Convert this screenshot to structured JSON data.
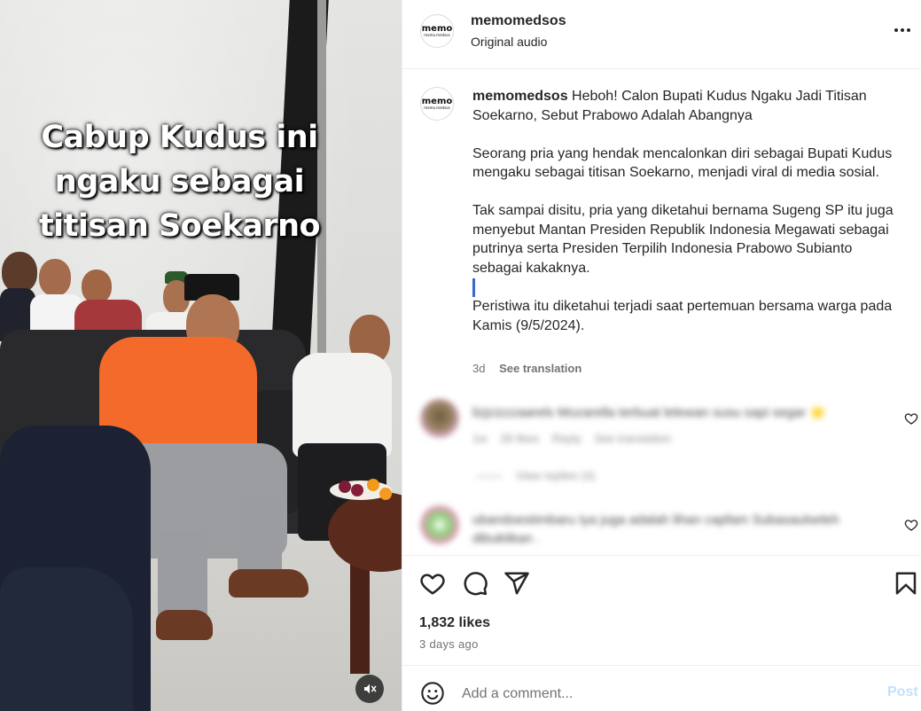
{
  "media": {
    "overlay_lines": [
      "Cabup Kudus ini",
      "ngaku sebagai",
      "titisan Soekarno"
    ],
    "mute_icon": "speaker-muted-icon"
  },
  "header": {
    "username": "memomedsos",
    "audio": "Original audio",
    "avatar_logo": "memo",
    "avatar_logo_sub": "memo.medsos"
  },
  "caption": {
    "username": "memomedsos",
    "paragraphs": [
      "Heboh! Calon Bupati Kudus Ngaku Jadi Titisan Soekarno, Sebut Prabowo Adalah Abangnya",
      "Seorang pria yang hendak mencalonkan diri sebagai Bupati Kudus mengaku sebagai titisan Soekarno, menjadi viral di media sosial.",
      "Tak sampai disitu, pria yang diketahui bernama Sugeng SP itu juga menyebut Mantan Presiden Republik Indonesia Megawati sebagai putrinya serta Presiden Terpilih Indonesia Prabowo Subianto sebagai kakaknya.",
      "Peristiwa itu diketahui terjadi saat pertemuan bersama warga pada Kamis (9/5/2024)."
    ],
    "time": "3d",
    "see_translation": "See translation"
  },
  "comments": [
    {
      "text": "lizjcizzzaarels Mozarella terbuat lelewan susu sapi segar 🌟",
      "time": "1w",
      "likes": "28 likes",
      "reply": "Reply",
      "translation": "See translation",
      "replies": "View replies (4)"
    },
    {
      "text": "ubandoestimbaru Iya juga adalah lihan capfam Subasaulseleh dibuktikan .",
      "time": "",
      "likes": "",
      "reply": "",
      "translation": "",
      "replies": ""
    }
  ],
  "actions": {
    "icons": [
      "heart-icon",
      "comment-icon",
      "share-icon",
      "bookmark-icon"
    ],
    "likes": "1,832 likes",
    "ago": "3 days ago"
  },
  "comment_box": {
    "placeholder": "Add a comment...",
    "post_label": "Post",
    "post_color": "#c4e0fb"
  },
  "colors": {
    "text": "#262626",
    "secondary": "#737373",
    "divider": "#efefef",
    "cursor": "#3a68c4"
  }
}
